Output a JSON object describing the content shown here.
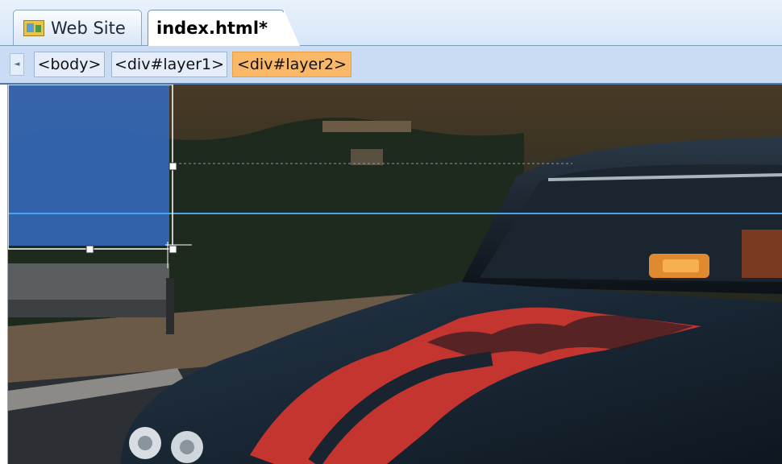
{
  "tabs": [
    {
      "label": "Web Site",
      "icon": "website-icon"
    },
    {
      "label": "index.html*",
      "active": true
    }
  ],
  "tag_selector": {
    "scroll_left": "◄",
    "tags": [
      "<body>",
      "<div#layer1>",
      "<div#layer2>"
    ],
    "selected": "<div#layer2>"
  },
  "canvas": {
    "background": "muscle car with flame-painted hood at dusk",
    "selected_layer": "div#layer2",
    "colors": {
      "layer_fill": "#3468b8",
      "guide_line": "#4aa3e8",
      "hood": "#1a2a3a",
      "flame": "#c43530"
    }
  }
}
